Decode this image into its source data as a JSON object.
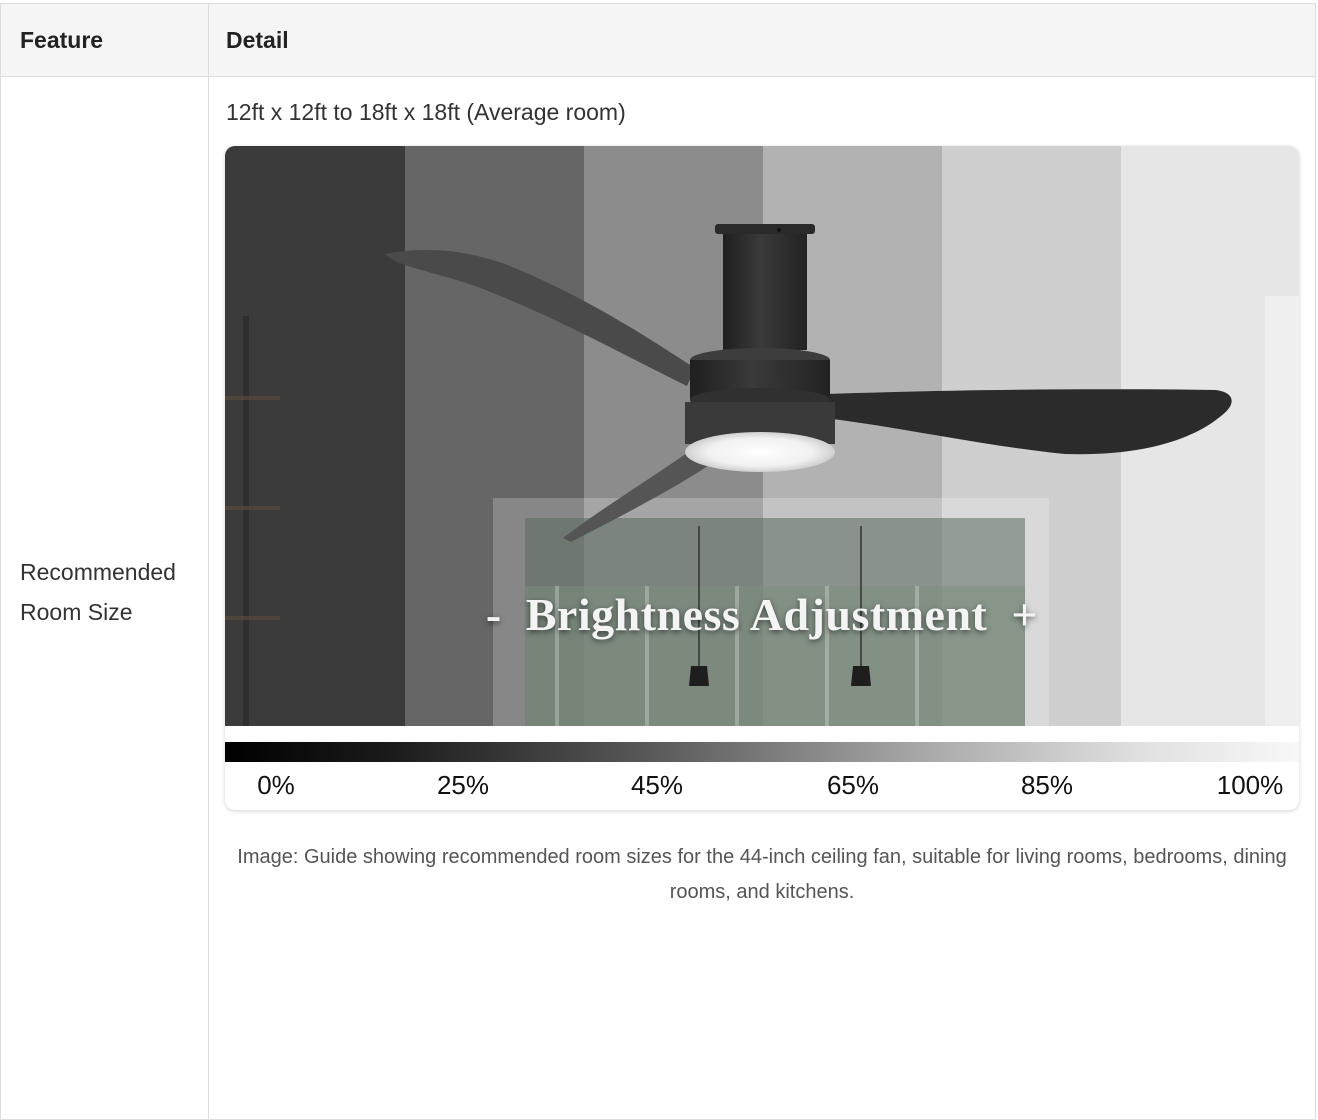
{
  "table": {
    "headers": {
      "feature": "Feature",
      "detail": "Detail"
    },
    "row": {
      "feature": "Recommended Room Size",
      "detail": "12ft x 12ft to 18ft x 18ft (Average room)"
    }
  },
  "figure": {
    "overlay_text": "-  Brightness Adjustment  +",
    "scale_labels": [
      "0%",
      "25%",
      "45%",
      "65%",
      "85%",
      "100%"
    ],
    "caption": "Image: Guide showing recommended room sizes for the 44-inch ceiling fan, suitable for living rooms, bedrooms, dining rooms, and kitchens."
  },
  "colors": {
    "border": "#dddddd",
    "header_bg": "#f5f5f5",
    "fan_body": "#2b2b2b"
  }
}
